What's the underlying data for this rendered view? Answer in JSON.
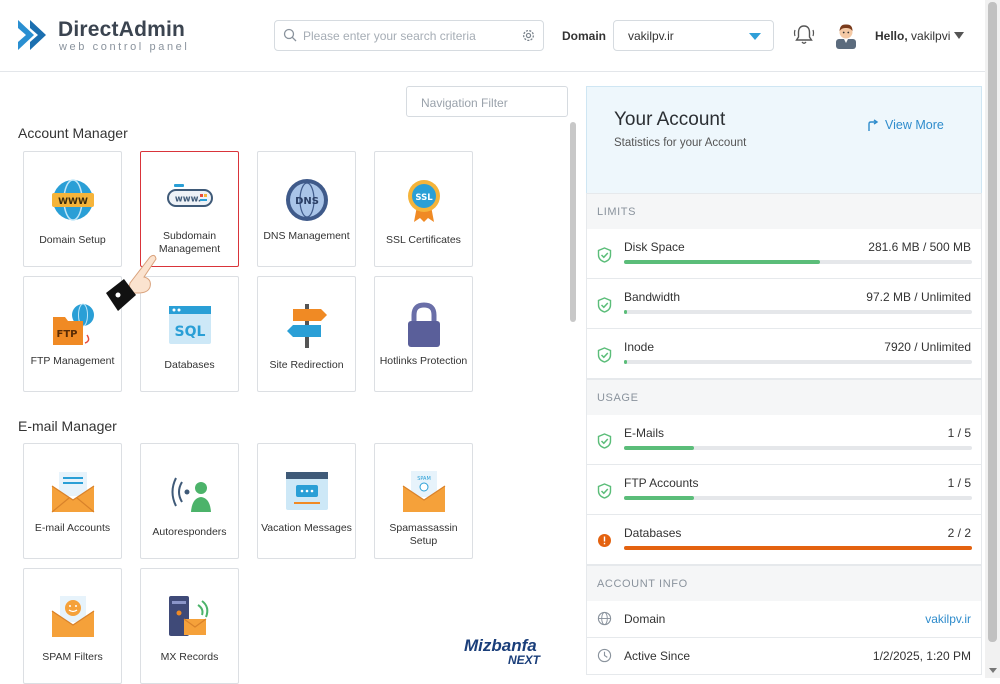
{
  "header": {
    "logo_title": "DirectAdmin",
    "logo_subtitle": "web control panel",
    "search_placeholder": "Please enter your search criteria",
    "domain_label": "Domain",
    "domain_value": "vakilpv.ir",
    "hello_prefix": "Hello,",
    "username": "vakilpvi"
  },
  "left": {
    "nav_filter_placeholder": "Navigation Filter",
    "sections": [
      {
        "title": "Account Manager",
        "items": [
          {
            "label": "Domain Setup",
            "icon": "www-globe-icon"
          },
          {
            "label": "Subdomain Management",
            "icon": "subdomain-icon",
            "active": true
          },
          {
            "label": "DNS Management",
            "icon": "dns-icon"
          },
          {
            "label": "SSL Certificates",
            "icon": "ssl-badge-icon"
          },
          {
            "label": "FTP Management",
            "icon": "ftp-folder-icon"
          },
          {
            "label": "Databases",
            "icon": "sql-database-icon"
          },
          {
            "label": "Site Redirection",
            "icon": "signpost-icon"
          },
          {
            "label": "Hotlinks Protection",
            "icon": "padlock-icon"
          }
        ]
      },
      {
        "title": "E-mail Manager",
        "items": [
          {
            "label": "E-mail Accounts",
            "icon": "email-envelope-icon"
          },
          {
            "label": "Autoresponders",
            "icon": "autoresponder-icon"
          },
          {
            "label": "Vacation Messages",
            "icon": "vacation-message-icon"
          },
          {
            "label": "Spamassassin Setup",
            "icon": "spam-envelope-icon"
          },
          {
            "label": "SPAM Filters",
            "icon": "spam-filter-icon"
          },
          {
            "label": "MX Records",
            "icon": "mx-records-icon"
          }
        ]
      }
    ],
    "brand_line1": "Mizbanfa",
    "brand_line2": "NEXT"
  },
  "account": {
    "title": "Your Account",
    "subtitle": "Statistics for your Account",
    "view_more": "View More"
  },
  "limits": {
    "heading": "LIMITS",
    "rows": [
      {
        "name": "Disk Space",
        "value": "281.6 MB / 500 MB",
        "fraction": 0.563,
        "status": "ok"
      },
      {
        "name": "Bandwidth",
        "value": "97.2 MB / Unlimited",
        "fraction": 0.01,
        "status": "ok"
      },
      {
        "name": "Inode",
        "value": "7920 / Unlimited",
        "fraction": 0.01,
        "status": "ok"
      }
    ]
  },
  "usage": {
    "heading": "USAGE",
    "rows": [
      {
        "name": "E-Mails",
        "value": "1 / 5",
        "fraction": 0.2,
        "status": "ok"
      },
      {
        "name": "FTP Accounts",
        "value": "1 / 5",
        "fraction": 0.2,
        "status": "ok"
      },
      {
        "name": "Databases",
        "value": "2 / 2",
        "fraction": 1.0,
        "status": "warning"
      }
    ]
  },
  "account_info": {
    "heading": "ACCOUNT INFO",
    "rows": [
      {
        "name": "Domain",
        "value": "vakilpv.ir",
        "icon": "globe-icon"
      },
      {
        "name": "Active Since",
        "value": "1/2/2025, 1:20 PM",
        "icon": "clock-icon"
      }
    ]
  },
  "colors": {
    "accent": "#2f8ccc",
    "ok_bar": "#5bbd79",
    "warn_bar": "#e4620f",
    "active_tile_border": "#d9343a"
  }
}
